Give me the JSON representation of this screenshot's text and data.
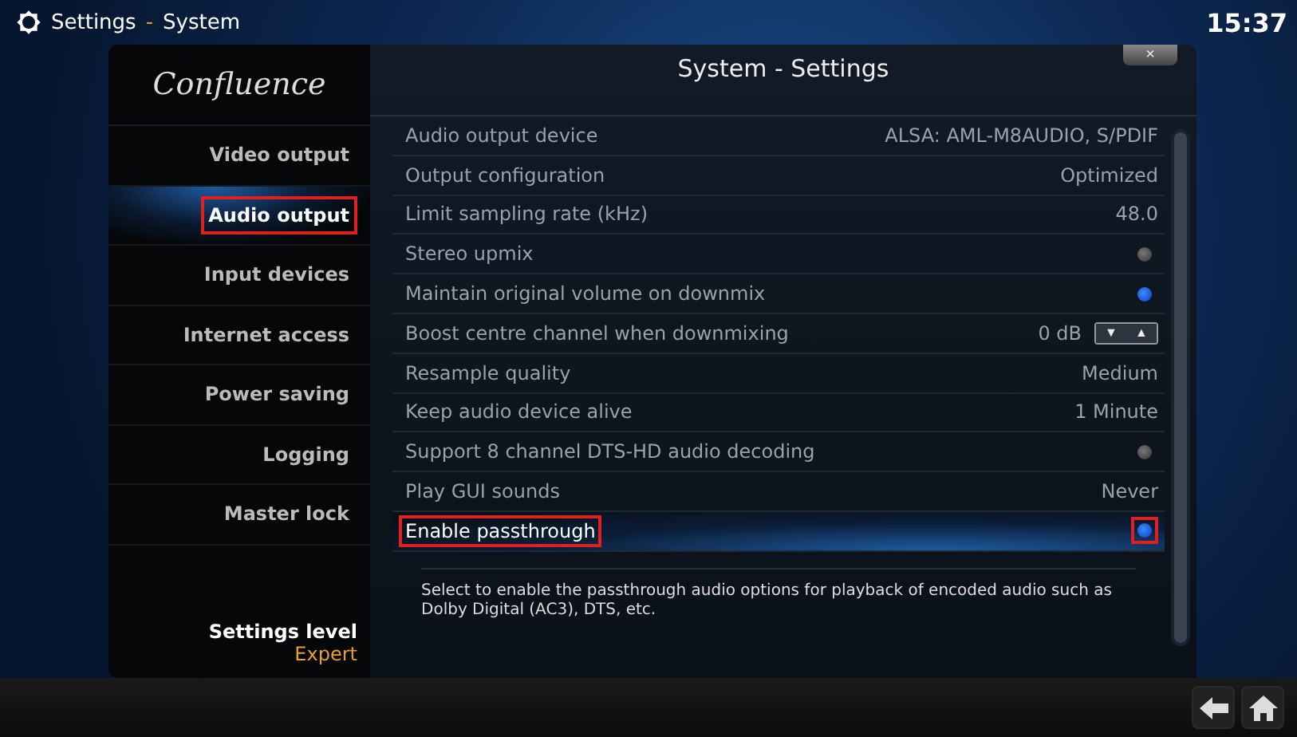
{
  "header": {
    "title": "Settings",
    "separator": "-",
    "subtitle": "System",
    "clock": "15:37"
  },
  "sidebar": {
    "logo": "Confluence",
    "items": [
      {
        "label": "Video output",
        "selected": false,
        "annotated": false
      },
      {
        "label": "Audio output",
        "selected": true,
        "annotated": true
      },
      {
        "label": "Input devices",
        "selected": false,
        "annotated": false
      },
      {
        "label": "Internet access",
        "selected": false,
        "annotated": false
      },
      {
        "label": "Power saving",
        "selected": false,
        "annotated": false
      },
      {
        "label": "Logging",
        "selected": false,
        "annotated": false
      },
      {
        "label": "Master lock",
        "selected": false,
        "annotated": false
      }
    ],
    "level_label": "Settings level",
    "level_value": "Expert"
  },
  "dialog": {
    "title": "System - Settings",
    "close": "×"
  },
  "settings": [
    {
      "kind": "value",
      "label": "Audio output device",
      "value": "ALSA: AML-M8AUDIO, S/PDIF",
      "selected": false,
      "annotated": false
    },
    {
      "kind": "value",
      "label": "Output configuration",
      "value": "Optimized",
      "selected": false,
      "annotated": false
    },
    {
      "kind": "value",
      "label": "Limit sampling rate (kHz)",
      "value": "48.0",
      "selected": false,
      "annotated": false
    },
    {
      "kind": "toggle",
      "label": "Stereo upmix",
      "on": false,
      "selected": false,
      "annotated": false
    },
    {
      "kind": "toggle",
      "label": "Maintain original volume on downmix",
      "on": true,
      "selected": false,
      "annotated": false
    },
    {
      "kind": "spinner",
      "label": "Boost centre channel when downmixing",
      "value": "0 dB",
      "down": "▼",
      "up": "▲",
      "selected": false,
      "annotated": false
    },
    {
      "kind": "value",
      "label": "Resample quality",
      "value": "Medium",
      "selected": false,
      "annotated": false
    },
    {
      "kind": "value",
      "label": "Keep audio device alive",
      "value": "1 Minute",
      "selected": false,
      "annotated": false
    },
    {
      "kind": "toggle",
      "label": "Support 8 channel DTS-HD audio decoding",
      "on": false,
      "selected": false,
      "annotated": false
    },
    {
      "kind": "value",
      "label": "Play GUI sounds",
      "value": "Never",
      "selected": false,
      "annotated": false
    },
    {
      "kind": "toggle",
      "label": "Enable passthrough",
      "on": true,
      "selected": true,
      "annotated": true
    }
  ],
  "description": "Select to enable the passthrough audio options for playback of encoded audio such as Dolby Digital (AC3), DTS, etc."
}
